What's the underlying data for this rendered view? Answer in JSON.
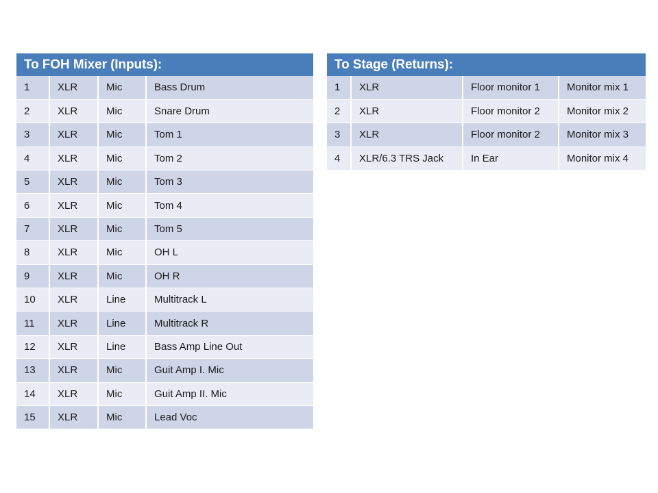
{
  "slide": {
    "background_color": "#ffffff",
    "accent_color": "#4a7ebb",
    "band_dark_color": "#ced5e7",
    "band_light_color": "#e9ecf5"
  },
  "foh_table": {
    "title": "To FOH Mixer (Inputs):",
    "rows": [
      {
        "num": "1",
        "connector": "XLR",
        "type": "Mic",
        "source": "Bass Drum"
      },
      {
        "num": "2",
        "connector": "XLR",
        "type": "Mic",
        "source": "Snare Drum"
      },
      {
        "num": "3",
        "connector": "XLR",
        "type": "Mic",
        "source": "Tom 1"
      },
      {
        "num": "4",
        "connector": "XLR",
        "type": "Mic",
        "source": "Tom 2"
      },
      {
        "num": "5",
        "connector": "XLR",
        "type": "Mic",
        "source": "Tom 3"
      },
      {
        "num": "6",
        "connector": "XLR",
        "type": "Mic",
        "source": "Tom 4"
      },
      {
        "num": "7",
        "connector": "XLR",
        "type": "Mic",
        "source": "Tom 5"
      },
      {
        "num": "8",
        "connector": "XLR",
        "type": "Mic",
        "source": "OH L"
      },
      {
        "num": "9",
        "connector": "XLR",
        "type": "Mic",
        "source": "OH R"
      },
      {
        "num": "10",
        "connector": "XLR",
        "type": "Line",
        "source": "Multitrack L"
      },
      {
        "num": "11",
        "connector": "XLR",
        "type": "Line",
        "source": "Multitrack R"
      },
      {
        "num": "12",
        "connector": "XLR",
        "type": "Line",
        "source": "Bass Amp Line Out"
      },
      {
        "num": "13",
        "connector": "XLR",
        "type": "Mic",
        "source": "Guit Amp I. Mic"
      },
      {
        "num": "14",
        "connector": "XLR",
        "type": "Mic",
        "source": "Guit Amp II. Mic"
      },
      {
        "num": "15",
        "connector": "XLR",
        "type": "Mic",
        "source": "Lead Voc"
      }
    ]
  },
  "stage_table": {
    "title": "To Stage (Returns):",
    "rows": [
      {
        "num": "1",
        "connector": "XLR",
        "destination": "Floor monitor 1",
        "mix": "Monitor mix 1"
      },
      {
        "num": "2",
        "connector": "XLR",
        "destination": "Floor monitor 2",
        "mix": "Monitor mix 2"
      },
      {
        "num": "3",
        "connector": "XLR",
        "destination": "Floor monitor 2",
        "mix": "Monitor mix 3"
      },
      {
        "num": "4",
        "connector": "XLR/6.3 TRS Jack",
        "destination": "In Ear",
        "mix": "Monitor mix 4"
      }
    ]
  }
}
